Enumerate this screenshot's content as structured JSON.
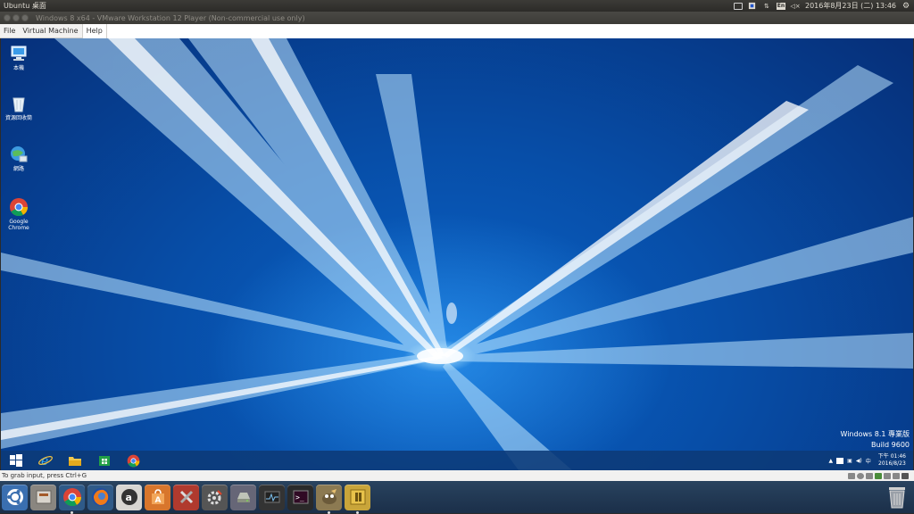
{
  "ubuntu_panel": {
    "title": "Ubuntu 桌面",
    "indicators": [
      {
        "name": "keyboard-icon",
        "label": ""
      },
      {
        "name": "dropbox-icon",
        "label": ""
      },
      {
        "name": "network-icon",
        "label": "⇅"
      },
      {
        "name": "input-method-icon",
        "label": "En"
      },
      {
        "name": "volume-icon",
        "label": "◁×"
      }
    ],
    "datetime": "2016年8月23日 (二) 13:46",
    "settings_icon": "gear-icon"
  },
  "vmware_window": {
    "title": "Windows 8 x64 - VMware Workstation 12 Player (Non-commercial use only)",
    "menu": [
      "File",
      "Virtual Machine",
      "Help"
    ],
    "status_text": "To grab input, press Ctrl+G"
  },
  "guest_desktop": {
    "icons": [
      {
        "name": "this-pc-icon",
        "label": "本機"
      },
      {
        "name": "recycle-bin-icon",
        "label": "資源回收筒"
      },
      {
        "name": "network-icon",
        "label": "網路"
      },
      {
        "name": "chrome-shortcut-icon",
        "label": "Google Chrome"
      }
    ],
    "watermark_line1": "Windows 8.1 專業版",
    "watermark_line2": "Build 9600",
    "taskbar": {
      "apps": [
        "start-button",
        "internet-explorer",
        "file-explorer",
        "windows-store",
        "google-chrome"
      ],
      "tray_ime": "中",
      "clock_time": "下午 01:46",
      "clock_date": "2016/8/23"
    }
  },
  "launcher": {
    "items": [
      "ubuntu-dash",
      "files",
      "chrome",
      "firefox",
      "amazon",
      "software-center",
      "system-tools",
      "system-settings",
      "disk-utility",
      "system-monitor",
      "terminal",
      "gimp",
      "vmware-player"
    ],
    "trash": "trash-icon"
  }
}
